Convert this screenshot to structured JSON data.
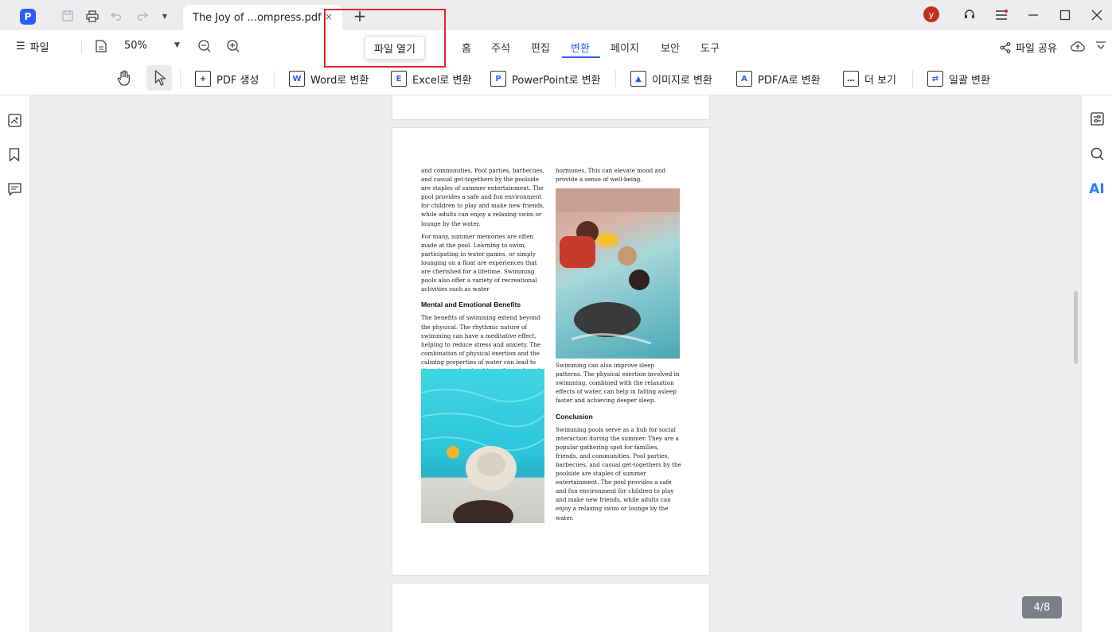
{
  "app": {
    "logo": "P",
    "tab_title": "The Joy of ...ompress.pdf",
    "tab_close": "×",
    "tab_add": "+",
    "avatar": "y"
  },
  "menu": {
    "file": "파일",
    "zoom": "50%",
    "tabs": [
      "홈",
      "주석",
      "편집",
      "변환",
      "페이지",
      "보안",
      "도구"
    ],
    "active_tab": "변환",
    "tooltip": "파일 열기",
    "share": "파일 공유"
  },
  "toolbar": {
    "create_pdf": "PDF 생성",
    "to_word": "Word로 변환",
    "to_excel": "Excel로 변환",
    "to_ppt": "PowerPoint로 변환",
    "to_image": "이미지로 변환",
    "to_pdfa": "PDF/A로 변환",
    "more": "더 보기",
    "batch": "일괄 변환"
  },
  "document": {
    "left_col_p1": "and communities. Pool parties, barbecues, and casual get-togethers by the poolside are staples of summer entertainment. The pool provides a safe and fun environment for children to play and make new friends, while adults can enjoy a relaxing swim or lounge by the water.",
    "left_col_p2": "For many, summer memories are often made at the pool. Learning to swim, participating in water games, or simply lounging on a float are experiences that are cherished for a lifetime. Swimming pools also offer a variety of recreational activities such as water",
    "heading_mental": "Mental and Emotional Benefits",
    "left_col_p3": "The benefits of swimming extend beyond the physical. The rhythmic nature of swimming can have a meditative effect, helping to reduce stress and anxiety. The combination of physical exertion and the calming properties of water can lead to the release of endorphins, often referred to as \"feel-good\"",
    "right_col_p1": "hormones. This can elevate mood and provide a sense of well-being.",
    "right_col_p2": "Swimming can also improve sleep patterns. The physical exertion involved in swimming, combined with the relaxation effects of water, can help in falling asleep faster and achieving deeper sleep.",
    "heading_conclusion": "Conclusion",
    "right_col_p3": "Swimming pools serve as a hub for social interaction during the summer. They are a popular gathering spot for families, friends, and communities. Pool parties, barbecues, and casual get-togethers by the poolside are staples of summer entertainment. The pool provides a safe and fun environment for children to play and make new friends, while adults can enjoy a relaxing swim or lounge by the water."
  },
  "page_indicator": "4/8",
  "colors": {
    "accent": "#2d5cf6",
    "highlight": "#e0262d",
    "avatar": "#c2311c"
  }
}
